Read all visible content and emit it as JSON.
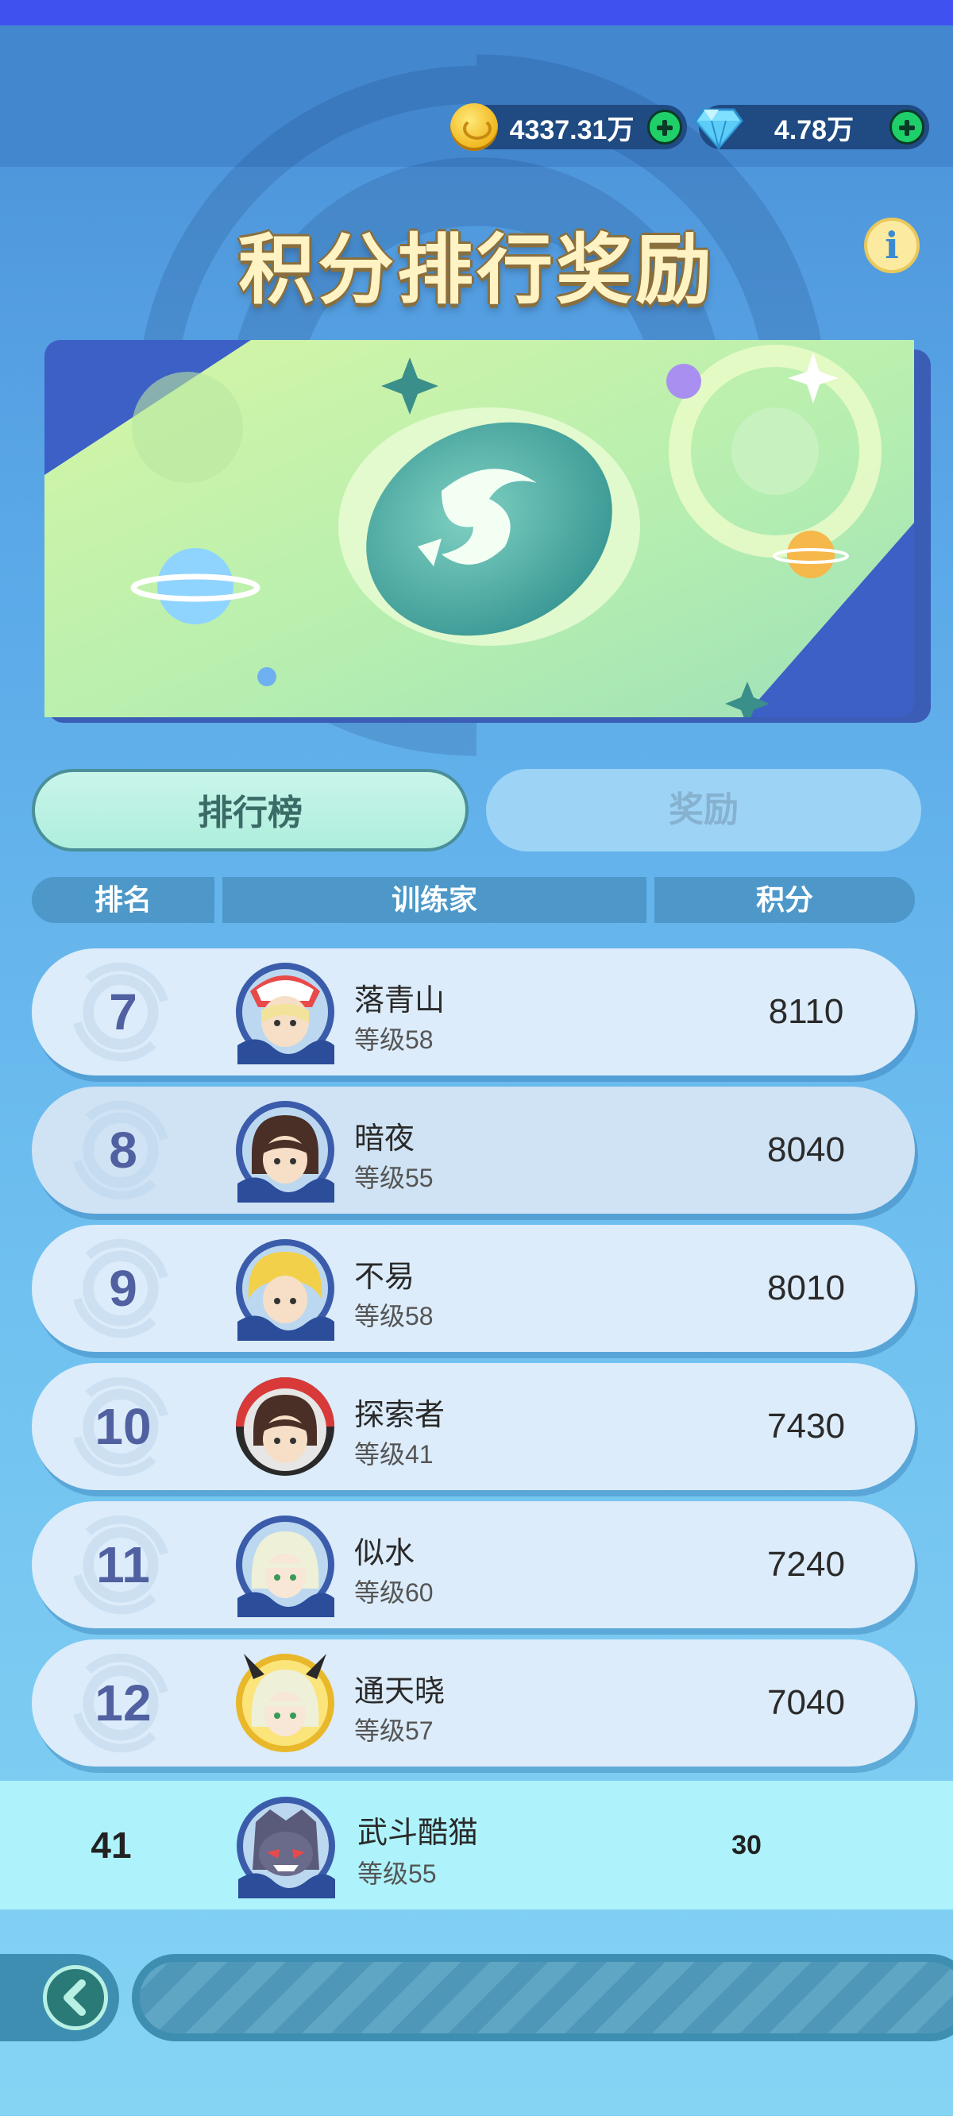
{
  "header": {
    "coins": "4337.31万",
    "gems": "4.78万",
    "title": "积分排行奖励",
    "info_symbol": "i"
  },
  "tabs": [
    {
      "label": "排行榜",
      "active": true
    },
    {
      "label": "奖励",
      "active": false
    }
  ],
  "table": {
    "columns": [
      "排名",
      "训练家",
      "积分"
    ],
    "rows": [
      {
        "rank": "7",
        "name": "落青山",
        "level": "等级58",
        "score": "8110"
      },
      {
        "rank": "8",
        "name": "暗夜",
        "level": "等级55",
        "score": "8040"
      },
      {
        "rank": "9",
        "name": "不易",
        "level": "等级58",
        "score": "8010"
      },
      {
        "rank": "10",
        "name": "探索者",
        "level": "等级41",
        "score": "7430"
      },
      {
        "rank": "11",
        "name": "似水",
        "level": "等级60",
        "score": "7240"
      },
      {
        "rank": "12",
        "name": "通天晓",
        "level": "等级57",
        "score": "7040"
      }
    ]
  },
  "me": {
    "rank": "41",
    "name": "武斗酷猫",
    "level": "等级55",
    "score": "30"
  },
  "colors": {
    "accent": "#3f52f0",
    "tab_active": "#aeeedc",
    "me_row": "#aef3fb"
  }
}
